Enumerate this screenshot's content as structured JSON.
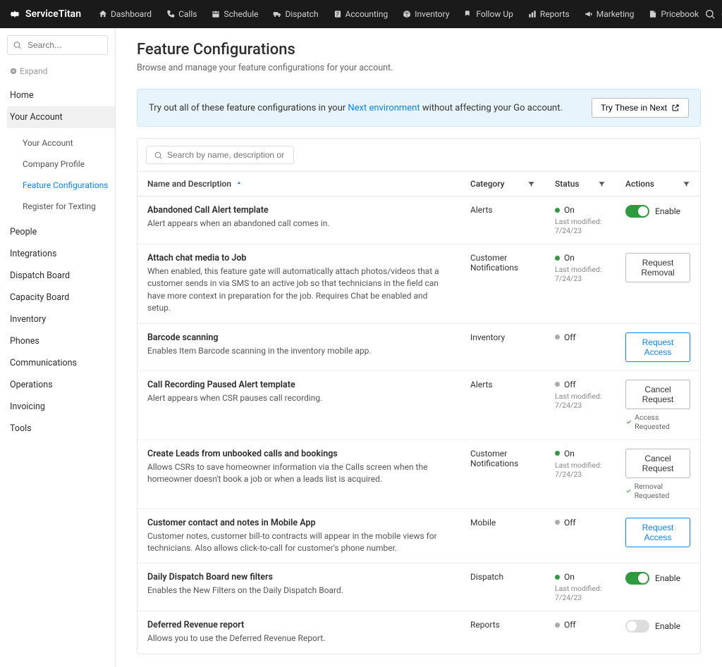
{
  "brand": "ServiceTitan",
  "topnav": {
    "items": [
      "Dashboard",
      "Calls",
      "Schedule",
      "Dispatch",
      "Accounting",
      "Inventory",
      "Follow Up",
      "Reports",
      "Marketing",
      "Pricebook"
    ]
  },
  "sidebar": {
    "search_placeholder": "Search...",
    "expand": "Expand",
    "items": [
      "Home",
      "Your Account"
    ],
    "sub_items": [
      "Your Account",
      "Company Profile",
      "Feature Configurations",
      "Register for Texting"
    ],
    "items2": [
      "People",
      "Integrations",
      "Dispatch Board",
      "Capacity Board",
      "Inventory",
      "Phones",
      "Communications",
      "Operations",
      "Invoicing",
      "Tools"
    ]
  },
  "page": {
    "title": "Feature Configurations",
    "subtitle": "Browse and manage your feature configurations for your account."
  },
  "callout": {
    "prefix": "Try out all of these feature configurations in your ",
    "link": "Next environment",
    "suffix": " without affecting your Go account.",
    "button": "Try These in Next"
  },
  "table": {
    "search_placeholder": "Search by name, description or category",
    "headers": {
      "name": "Name and Description",
      "category": "Category",
      "status": "Status",
      "actions": "Actions"
    },
    "status_on": "On",
    "status_off": "Off",
    "modified_prefix": "Last modified: ",
    "enable_label": "Enable",
    "buttons": {
      "request_removal": "Request Removal",
      "request_access": "Request Access",
      "cancel_request": "Cancel Request"
    },
    "substatus": {
      "access_requested": "Access Requested",
      "removal_requested": "Removal Requested"
    },
    "rows": [
      {
        "name": "Abandoned Call Alert template",
        "desc": "Alert appears when an abandoned call comes in.",
        "category": "Alerts",
        "status": "on",
        "modified": "7/24/23",
        "action": {
          "type": "toggle",
          "on": true
        }
      },
      {
        "name": "Attach chat media to Job",
        "desc": "When enabled, this feature gate will automatically attach photos/videos that a customer sends in via SMS to an active job so that technicians in the field can have more context in preparation for the job. Requires Chat be enabled and setup.",
        "category": "Customer Notifications",
        "status": "on",
        "modified": "7/24/23",
        "action": {
          "type": "button",
          "style": "gray",
          "label": "request_removal"
        }
      },
      {
        "name": "Barcode scanning",
        "desc": "Enables Item Barcode scanning in the inventory mobile app.",
        "category": "Inventory",
        "status": "off",
        "modified": "",
        "action": {
          "type": "button",
          "style": "blue",
          "label": "request_access"
        }
      },
      {
        "name": "Call Recording Paused Alert template",
        "desc": "Alert appears when CSR pauses call recording.",
        "category": "Alerts",
        "status": "off",
        "modified": "7/24/23",
        "action": {
          "type": "button",
          "style": "gray",
          "label": "cancel_request",
          "sub": "access_requested"
        }
      },
      {
        "name": "Create Leads from unbooked calls and bookings",
        "desc": "Allows CSRs to save homeowner information via the Calls screen when the homeowner doesn't book a job or when a leads list is acquired.",
        "category": "Customer Notifications",
        "status": "on",
        "modified": "7/24/23",
        "action": {
          "type": "button",
          "style": "gray",
          "label": "cancel_request",
          "sub": "removal_requested"
        }
      },
      {
        "name": "Customer contact and notes in Mobile App",
        "desc": "Customer notes, customer bill-to contracts will appear in the mobile views for technicians. Also allows click-to-call for customer's phone number.",
        "category": "Mobile",
        "status": "off",
        "modified": "",
        "action": {
          "type": "button",
          "style": "blue",
          "label": "request_access"
        }
      },
      {
        "name": "Daily Dispatch Board new filters",
        "desc": "Enables the New Filters on the Daily Dispatch Board.",
        "category": "Dispatch",
        "status": "on",
        "modified": "7/24/23",
        "action": {
          "type": "toggle",
          "on": true
        }
      },
      {
        "name": "Deferred Revenue report",
        "desc": "Allows you to use the Deferred Revenue Report.",
        "category": "Reports",
        "status": "off",
        "modified": "",
        "action": {
          "type": "toggle",
          "on": false
        }
      }
    ]
  }
}
